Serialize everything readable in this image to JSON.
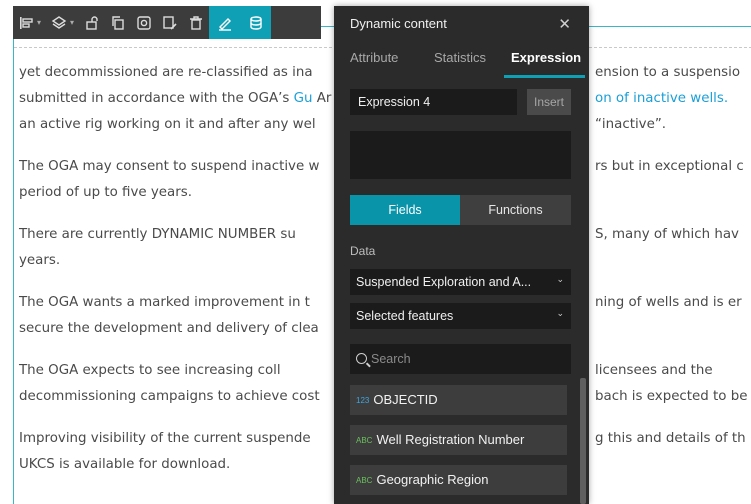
{
  "toolbar": {
    "buttons": [
      {
        "name": "align-icon",
        "glyph": "⊫",
        "caret": "⌄"
      },
      {
        "name": "layers-icon",
        "glyph": "◈",
        "caret": "⌄"
      },
      {
        "name": "unlock-icon",
        "glyph": "🔓"
      },
      {
        "name": "copy-icon",
        "glyph": "⧉"
      },
      {
        "name": "target-icon",
        "glyph": "◎"
      },
      {
        "name": "edit-doc-icon",
        "glyph": "✎"
      },
      {
        "name": "trash-icon",
        "glyph": "🗑"
      },
      {
        "name": "pencil-icon",
        "glyph": "✐"
      },
      {
        "name": "database-icon",
        "glyph": "⛁"
      }
    ],
    "active_color": "#0fa0b6"
  },
  "document": {
    "paragraphs": [
      {
        "lines": [
          {
            "parts": [
              {
                "t": "yet decommissioned are re-classified as ina"
              },
              {
                "t": "ension to a suspensio",
                "gap": true
              }
            ]
          },
          {
            "parts": [
              {
                "t": "submitted in accordance with the OGA’s "
              },
              {
                "t": "Gu",
                "link": true
              },
              {
                "t": "on of inactive wells.",
                "link": true,
                "gap": true
              },
              {
                "t": " Ar"
              }
            ]
          },
          {
            "parts": [
              {
                "t": "an active rig working on it and after any wel"
              },
              {
                "t": "“inactive”.",
                "gap": true
              }
            ]
          }
        ]
      },
      {
        "lines": [
          {
            "parts": [
              {
                "t": "The OGA may consent to suspend inactive w"
              },
              {
                "t": "rs but in exceptional c",
                "gap": true
              }
            ]
          },
          {
            "parts": [
              {
                "t": "period of up to five years."
              }
            ]
          }
        ]
      },
      {
        "lines": [
          {
            "parts": [
              {
                "t": "There are currently DYNAMIC NUMBER su"
              },
              {
                "t": "S, many of which hav",
                "gap": true
              }
            ]
          },
          {
            "parts": [
              {
                "t": "years."
              }
            ]
          }
        ]
      },
      {
        "lines": [
          {
            "parts": [
              {
                "t": "The OGA wants a marked improvement in t"
              },
              {
                "t": "ning of wells and is er",
                "gap": true
              }
            ]
          },
          {
            "parts": [
              {
                "t": "secure the development and delivery of clea"
              }
            ]
          }
        ]
      },
      {
        "lines": [
          {
            "parts": [
              {
                "t": "The OGA expects to see increasing coll"
              },
              {
                "t": "licensees and the",
                "gap": true
              }
            ]
          },
          {
            "parts": [
              {
                "t": "decommissioning campaigns to achieve cost"
              },
              {
                "t": "bach is expected to be",
                "gap": true
              }
            ]
          }
        ]
      },
      {
        "lines": [
          {
            "parts": [
              {
                "t": "Improving visibility of the current suspende"
              },
              {
                "t": "g this and details of th",
                "gap": true
              }
            ]
          },
          {
            "parts": [
              {
                "t": "UKCS is available for download."
              }
            ]
          }
        ]
      }
    ]
  },
  "panel": {
    "title": "Dynamic content",
    "close_glyph": "✕",
    "tabs": [
      "Attribute",
      "Statistics",
      "Expression"
    ],
    "active_tab": "Expression",
    "expression_name": "Expression 4",
    "insert_label": "Insert",
    "seg_fields": "Fields",
    "seg_functions": "Functions",
    "data_label": "Data",
    "layer_select": "Suspended Exploration and A...",
    "feature_select": "Selected features",
    "search_placeholder": "Search",
    "fields": [
      {
        "tag": "123",
        "label": "OBJECTID"
      },
      {
        "tag": "ABC",
        "label": "Well Registration Number"
      },
      {
        "tag": "ABC",
        "label": "Geographic Region"
      }
    ]
  }
}
